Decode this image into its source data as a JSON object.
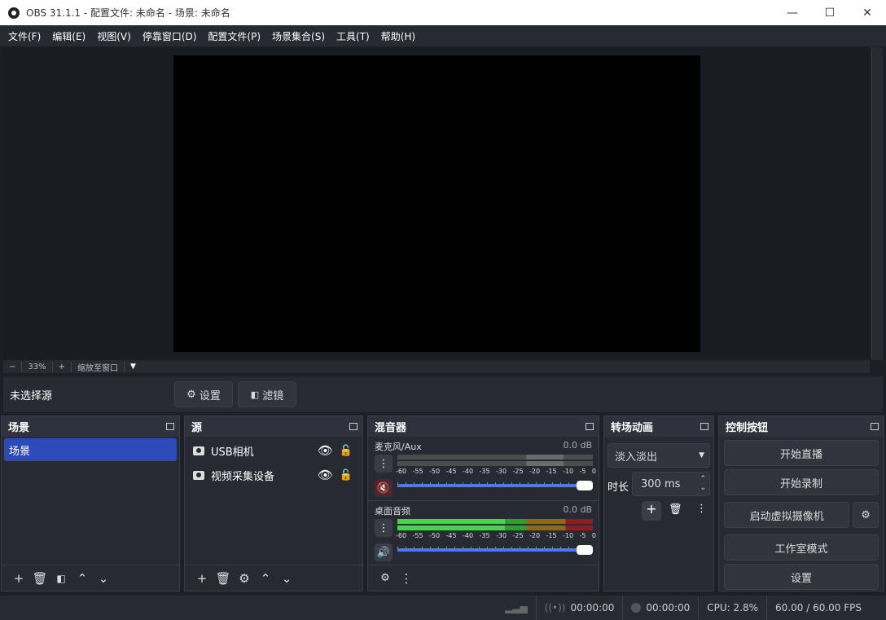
{
  "window": {
    "title": "OBS 31.1.1 - 配置文件: 未命名 - 场景: 未命名",
    "minimize": "—",
    "maximize": "☐",
    "close": "✕"
  },
  "menu": [
    "文件(F)",
    "编辑(E)",
    "视图(V)",
    "停靠窗口(D)",
    "配置文件(P)",
    "场景集合(S)",
    "工具(T)",
    "帮助(H)"
  ],
  "zoom": {
    "minus": "−",
    "value": "33%",
    "plus": "+",
    "fit": "缩放至窗口",
    "dropdown": "▼"
  },
  "source_bar": {
    "label": "未选择源",
    "settings": "设置",
    "filters": "滤镜"
  },
  "scenes": {
    "title": "场景",
    "items": [
      "场景"
    ]
  },
  "sources": {
    "title": "源",
    "items": [
      {
        "name": "USB相机"
      },
      {
        "name": "视频采集设备"
      }
    ]
  },
  "mixer": {
    "title": "混音器",
    "channels": [
      {
        "name": "麦克风/Aux",
        "db": "0.0 dB",
        "muted": true
      },
      {
        "name": "桌面音频",
        "db": "0.0 dB",
        "muted": false
      }
    ],
    "scale": [
      "-60",
      "-55",
      "-50",
      "-45",
      "-40",
      "-35",
      "-30",
      "-25",
      "-20",
      "-15",
      "-10",
      "-5",
      "0"
    ]
  },
  "transitions": {
    "title": "转场动画",
    "selected": "淡入淡出",
    "duration_label": "时长",
    "duration": "300 ms"
  },
  "controls": {
    "title": "控制按钮",
    "start_stream": "开始直播",
    "start_record": "开始录制",
    "virtual_cam": "启动虚拟摄像机",
    "studio_mode": "工作室模式",
    "settings": "设置"
  },
  "status": {
    "stream_time": "00:00:00",
    "record_time": "00:00:00",
    "cpu": "CPU: 2.8%",
    "fps": "60.00 / 60.00 FPS"
  }
}
